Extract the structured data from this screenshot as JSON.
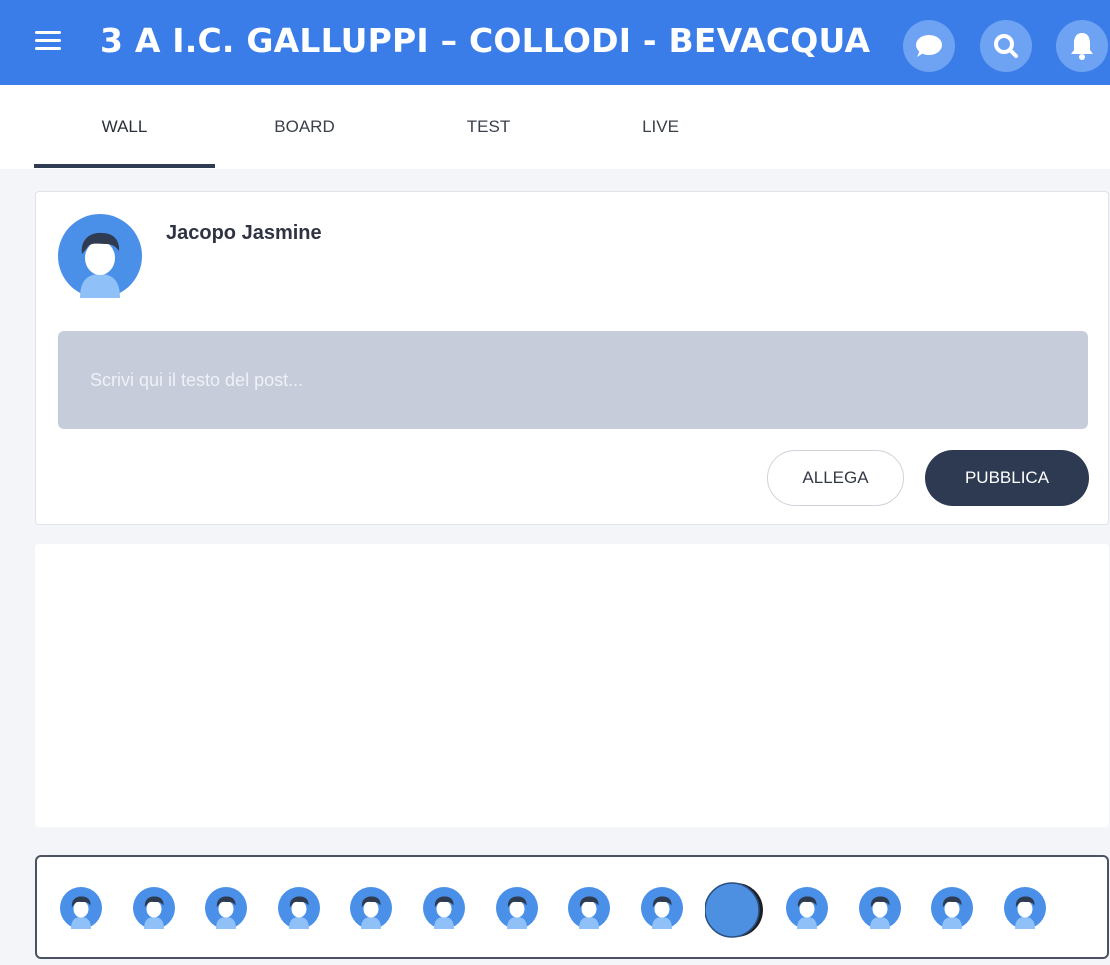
{
  "header": {
    "title": "3 A I.C. GALLUPPI – COLLODI - BEVACQUA",
    "menu_icon": "hamburger-menu-icon",
    "buttons": [
      "chat-bubble-icon",
      "search-icon",
      "bell-icon"
    ],
    "color": "#3b7de8"
  },
  "tabs": [
    {
      "label": "WALL",
      "active": true
    },
    {
      "label": "BOARD",
      "active": false
    },
    {
      "label": "TEST",
      "active": false
    },
    {
      "label": "LIVE",
      "active": false
    }
  ],
  "composer": {
    "author": "Jacopo Jasmine",
    "placeholder": "Scrivi qui il testo del post...",
    "attach_label": "ALLEGA",
    "publish_label": "PUBBLICA"
  },
  "members": {
    "count": 14,
    "highlighted_index": 9
  }
}
